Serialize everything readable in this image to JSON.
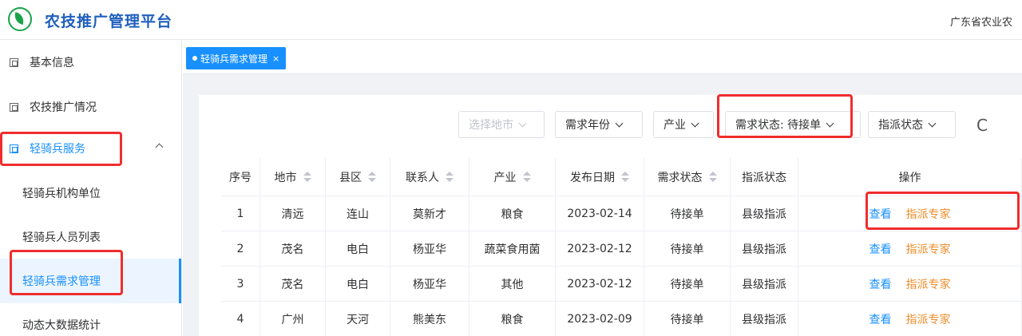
{
  "app": {
    "title": "农技推广管理平台",
    "org": "广东省农业农"
  },
  "sidebar": {
    "items": [
      {
        "label": "基本信息"
      },
      {
        "label": "农技推广情况"
      },
      {
        "label": "轻骑兵服务"
      }
    ],
    "sub_items": [
      {
        "label": "轻骑兵机构单位"
      },
      {
        "label": "轻骑兵人员列表"
      },
      {
        "label": "轻骑兵需求管理"
      },
      {
        "label": "动态大数据统计"
      }
    ]
  },
  "tabs": [
    {
      "label": "轻骑兵需求管理",
      "close": "×"
    }
  ],
  "filters": {
    "city": "选择地市",
    "year": "需求年份",
    "industry": "产业",
    "status": "需求状态: 待接单",
    "assign": "指派状态",
    "refresh": "C"
  },
  "table": {
    "headers": [
      "序号",
      "地市",
      "县区",
      "联系人",
      "产业",
      "发布日期",
      "需求状态",
      "指派状态",
      "操作"
    ],
    "rows": [
      {
        "no": "1",
        "city": "清远",
        "district": "连山",
        "contact": "莫新才",
        "industry": "粮食",
        "date": "2023-02-14",
        "status": "待接单",
        "assign": "县级指派"
      },
      {
        "no": "2",
        "city": "茂名",
        "district": "电白",
        "contact": "杨亚华",
        "industry": "蔬菜食用菌",
        "date": "2023-02-12",
        "status": "待接单",
        "assign": "县级指派"
      },
      {
        "no": "3",
        "city": "茂名",
        "district": "电白",
        "contact": "杨亚华",
        "industry": "其他",
        "date": "2023-02-12",
        "status": "待接单",
        "assign": "县级指派"
      },
      {
        "no": "4",
        "city": "广州",
        "district": "天河",
        "contact": "熊美东",
        "industry": "粮食",
        "date": "2023-02-09",
        "status": "待接单",
        "assign": "县级指派"
      }
    ],
    "action_view": "查看",
    "action_assign": "指派专家"
  },
  "colors": {
    "primary": "#1890ff",
    "brand": "#1f5fbf",
    "action_warn": "#f08c2a",
    "highlight": "#f02d2d"
  }
}
